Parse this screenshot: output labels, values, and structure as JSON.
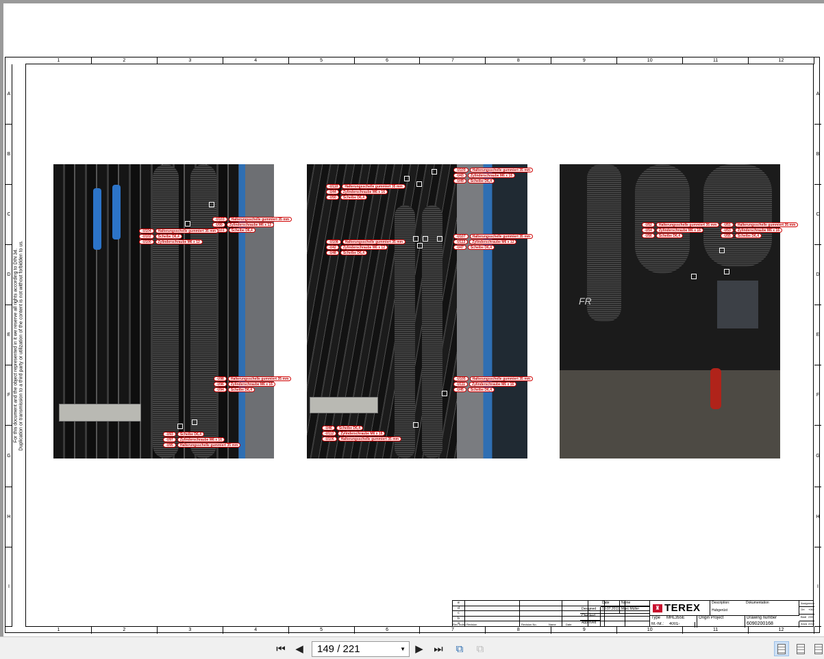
{
  "viewer": {
    "page_indicator": "149 / 221",
    "buttons": {
      "first": "first-page",
      "prev": "previous-page",
      "next": "next-page",
      "last": "last-page"
    }
  },
  "drawing": {
    "columns": [
      "1",
      "2",
      "3",
      "4",
      "5",
      "6",
      "7",
      "8",
      "9",
      "10",
      "11",
      "12"
    ],
    "rows": [
      "A",
      "B",
      "C",
      "D",
      "E",
      "F",
      "G",
      "H",
      "I"
    ],
    "side_note": [
      "For this document and the object represented in it we reserve all rights according to DIN 34.",
      "Duplication or transmission to a third party or utilization of the content is not without forbidden to us."
    ],
    "photos": [
      {
        "groups": [
          [
            [
              "-U103",
              "Halterungsschelle gummiert 35 mm"
            ],
            [
              "-U99",
              "Zylinderschraube M6 x 12"
            ],
            [
              "-U101",
              "Scheibe D6,4"
            ]
          ],
          [
            [
              "-U104",
              "Halterungsschelle gummiert 35 mm"
            ],
            [
              "-U102",
              "Scheibe D6,4"
            ],
            [
              "-U100",
              "Zylinderschraube M6 x 12"
            ]
          ],
          [
            [
              "-U98",
              "Halterungsschelle gummiert 35 mm"
            ],
            [
              "-U96",
              "Zylinderschraube M6 x 16"
            ],
            [
              "-U94",
              "Scheibe D6,4"
            ]
          ],
          [
            [
              "-U93",
              "Scheibe D6,4"
            ],
            [
              "-U97",
              "Zylinderschraube M6 x 16"
            ],
            [
              "-U95",
              "Halterungsschelle gummiert 35 mm"
            ]
          ]
        ]
      },
      {
        "groups": [
          [
            [
              "-U109",
              "Halterungsschelle gummiert 35 mm"
            ],
            [
              "-U43",
              "Zylinderschraube M6 x 16"
            ],
            [
              "-U49",
              "Scheibe D6,4"
            ]
          ],
          [
            [
              "-U110",
              "Halterungsschelle gummiert 35 mm"
            ],
            [
              "-U44",
              "Zylinderschraube M6 x 16"
            ],
            [
              "-U50",
              "Scheibe D6,4"
            ]
          ],
          [
            [
              "-U107",
              "Halterungsschelle gummiert 35 mm"
            ],
            [
              "-U113",
              "Zylinderschraube M6 x 12"
            ],
            [
              "-U47",
              "Scheibe D6,4"
            ]
          ],
          [
            [
              "-U108",
              "Halterungsschelle gummiert 35 mm"
            ],
            [
              "-U42",
              "Zylinderschraube M6 x 12"
            ],
            [
              "-U48",
              "Scheibe D6,4"
            ]
          ],
          [
            [
              "-U105",
              "Halterungsschelle gummiert 35 mm"
            ],
            [
              "-U111",
              "Zylinderschraube M6 x 16"
            ],
            [
              "-U45",
              "Scheibe D6,4"
            ]
          ],
          [
            [
              "-U46",
              "Scheibe D6,4"
            ],
            [
              "-U112",
              "Zylinderschraube M6 x 16"
            ],
            [
              "-U106",
              "Halterungsschelle gummiert 35 mm"
            ]
          ]
        ]
      },
      {
        "groups": [
          [
            [
              "-U52",
              "Halterungsschelle gummiert 35 mm"
            ],
            [
              "-U54",
              "Zylinderschraube M6 x 16"
            ],
            [
              "-U56",
              "Scheibe D6,4"
            ]
          ],
          [
            [
              "-U51",
              "Halterungsschelle gummiert 35 mm"
            ],
            [
              "-U53",
              "Zylinderschraube M6 x 16"
            ],
            [
              "-U55",
              "Scheibe D6,4"
            ]
          ]
        ]
      }
    ],
    "photo3_text": "FR",
    "title_block": {
      "rev_letters": [
        "e",
        "d",
        "c",
        "b",
        "a"
      ],
      "rev_headers": {
        "rev_index": "Rev. Index",
        "revision": "Revision",
        "revision_no": "Revision No.",
        "name": "Name",
        "date": "Date"
      },
      "date_label": "Date",
      "name_label": "Name",
      "designed_label": "Designed",
      "designed_date": "19.07.2011",
      "designed_name": "Marc Müller",
      "checked_label": "Checked",
      "approved_label": "Approved",
      "logo": "TEREX",
      "description_label": "Description:",
      "description_value": "Dokumentation",
      "subtitle": "Hubgerüst",
      "type_label": "Type",
      "type_value": "MHL355E",
      "mnr_label": "M.-Nr.:",
      "mnr_value": "4001-",
      "origin_label": "Origin Project",
      "drawing_number_label": "Drawing number",
      "drawing_number": "6090200168",
      "assignment_label": "Assignment",
      "ort_label": "Ort",
      "ort_value": "+06.1",
      "blatt_label": "Blatt",
      "blatt_value": "239",
      "anzahl_label": "Anzahl",
      "anzahl_value": "2218L"
    }
  },
  "colors": {
    "label_red": "#d00000",
    "toolbar_bg": "#f0f0f0",
    "terex_red": "#c8102e"
  }
}
